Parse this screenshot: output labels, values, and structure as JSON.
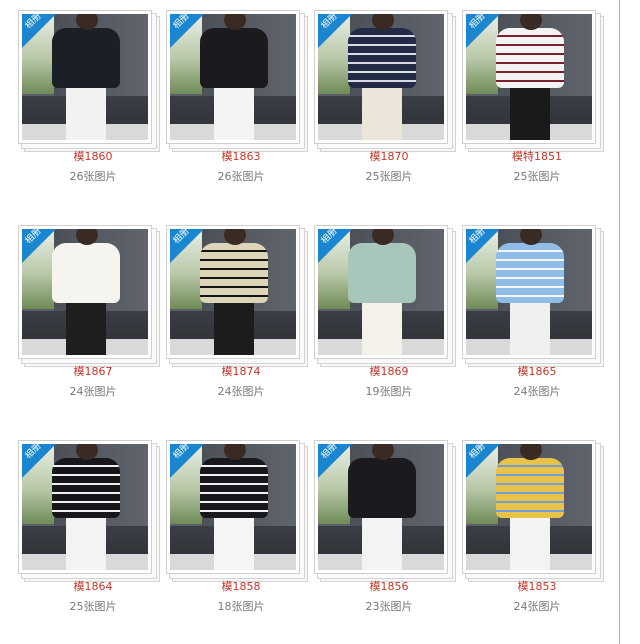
{
  "badge_label": "相册",
  "colors": {
    "badge": "#1a86d0",
    "title": "#c0392b",
    "count": "#777777"
  },
  "albums": [
    {
      "title": "模1860",
      "count": "26张图片",
      "garment": "#1d1f26",
      "legs": "#f2f2f2",
      "stripes": ""
    },
    {
      "title": "模1863",
      "count": "26张图片",
      "garment": "#1b1b1f",
      "legs": "#f4f4f4",
      "stripes": ""
    },
    {
      "title": "模1870",
      "count": "25张图片",
      "garment": "#232a45",
      "legs": "#ece6da",
      "stripes": "#d8dce6"
    },
    {
      "title": "模特1851",
      "count": "25张图片",
      "garment": "#f3f3f3",
      "legs": "#1a1a1a",
      "stripes": "#7b1f2e"
    },
    {
      "title": "模1867",
      "count": "24张图片",
      "garment": "#f5f4ef",
      "legs": "#1e1e1e",
      "stripes": ""
    },
    {
      "title": "模1874",
      "count": "24张图片",
      "garment": "#ddd5b8",
      "legs": "#1c1c1c",
      "stripes": "#151515"
    },
    {
      "title": "模1869",
      "count": "19张图片",
      "garment": "#a9c6bd",
      "legs": "#f3f1ea",
      "stripes": ""
    },
    {
      "title": "模1865",
      "count": "24张图片",
      "garment": "#8fbde8",
      "legs": "#f0f0f0",
      "stripes": "#f5f5f5"
    },
    {
      "title": "模1864",
      "count": "25张图片",
      "garment": "#17171b",
      "legs": "#f3f3f3",
      "stripes": "#f0f0f0"
    },
    {
      "title": "模1858",
      "count": "18张图片",
      "garment": "#19191d",
      "legs": "#f5f5f5",
      "stripes": "#f2f2f2"
    },
    {
      "title": "模1856",
      "count": "23张图片",
      "garment": "#1a1a1f",
      "legs": "#f3f3f3",
      "stripes": ""
    },
    {
      "title": "模1853",
      "count": "24张图片",
      "garment": "#e9c24a",
      "legs": "#f3f3f3",
      "stripes": "#6f9fd6"
    }
  ]
}
